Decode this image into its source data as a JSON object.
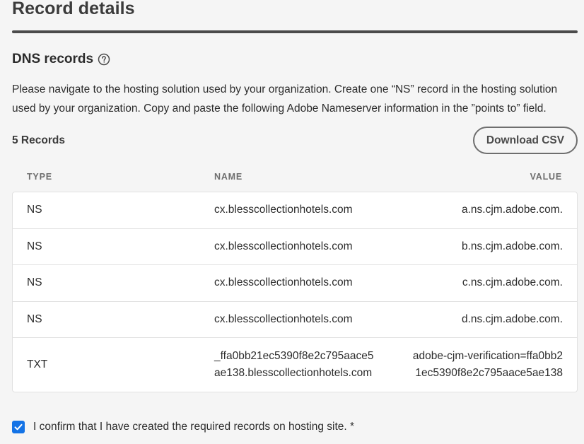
{
  "page": {
    "title": "Record details"
  },
  "dns": {
    "section_title": "DNS records",
    "help_icon": "help-circle-icon",
    "description": "Please navigate to the hosting solution used by your organization. Create one “NS” record in the hosting solution used by your organization. Copy and paste the following Adobe Nameserver information in the ”points to” field.",
    "record_count": "5 Records",
    "download_label": "Download CSV",
    "columns": {
      "type": "TYPE",
      "name": "NAME",
      "value": "VALUE"
    },
    "rows": [
      {
        "type": "NS",
        "name": "cx.blesscollectionhotels.com",
        "value": "a.ns.cjm.adobe.com."
      },
      {
        "type": "NS",
        "name": "cx.blesscollectionhotels.com",
        "value": "b.ns.cjm.adobe.com."
      },
      {
        "type": "NS",
        "name": "cx.blesscollectionhotels.com",
        "value": "c.ns.cjm.adobe.com."
      },
      {
        "type": "NS",
        "name": "cx.blesscollectionhotels.com",
        "value": "d.ns.cjm.adobe.com."
      },
      {
        "type": "TXT",
        "name_line1": "_ffa0bb21ec5390f8e2c795aace5",
        "name_line2": "ae138.blesscollectionhotels.com",
        "value_line1": "adobe-cjm-verification=ffa0bb2",
        "value_line2": "1ec5390f8e2c795aace5ae138"
      }
    ]
  },
  "confirm": {
    "checked": true,
    "label": "I confirm that I have created the required records on hosting site. *",
    "check_icon": "checkmark-icon"
  },
  "colors": {
    "accent": "#1473e6",
    "rule": "#4b4b4b"
  }
}
